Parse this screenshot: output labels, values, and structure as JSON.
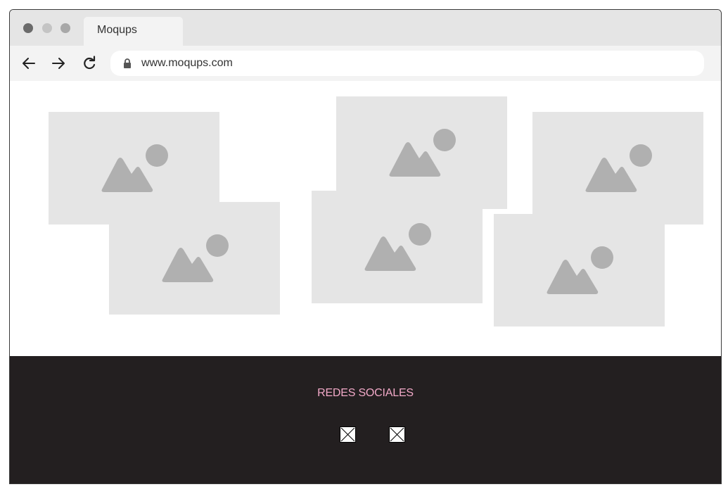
{
  "browser": {
    "tab_title": "Moqups",
    "url": "www.moqups.com"
  },
  "content": {
    "image_placeholders": [
      {
        "name": "image-placeholder-1"
      },
      {
        "name": "image-placeholder-2"
      },
      {
        "name": "image-placeholder-3"
      },
      {
        "name": "image-placeholder-4"
      },
      {
        "name": "image-placeholder-5"
      },
      {
        "name": "image-placeholder-6"
      }
    ]
  },
  "footer": {
    "title": "REDES SOCIALES",
    "social_icons": [
      "broken-image-icon",
      "broken-image-icon"
    ]
  },
  "colors": {
    "footer_bg": "#231f20",
    "footer_title": "#f2a9c8",
    "placeholder_bg": "#e5e5e5",
    "placeholder_icon": "#b0b0b0"
  }
}
